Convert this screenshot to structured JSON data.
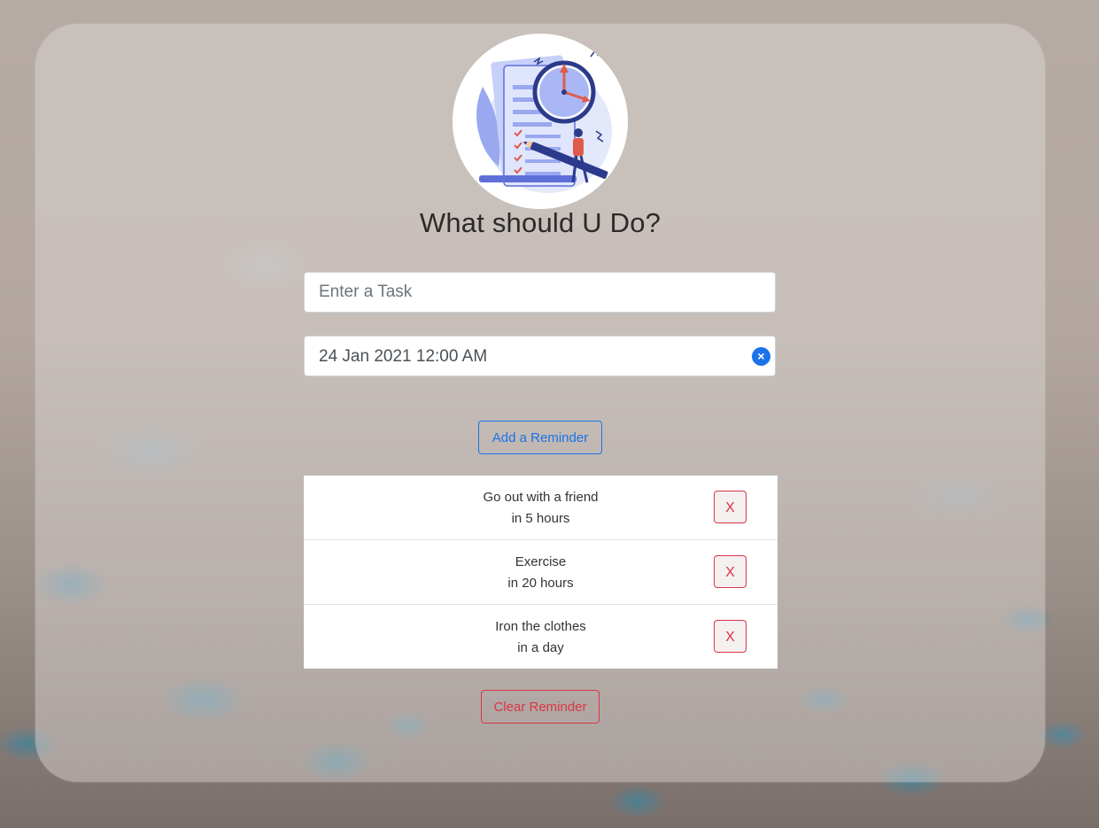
{
  "app": {
    "title": "What should U Do?",
    "logo_icon": "task-clock-illustration-icon"
  },
  "form": {
    "task_placeholder": "Enter a Task",
    "task_value": "",
    "date_value": "24 Jan 2021 12:00 AM",
    "date_clear_symbol": "×",
    "add_button_label": "Add a Reminder"
  },
  "reminders": [
    {
      "text": "Go out with a friend",
      "time": "in 5 hours",
      "delete_label": "X"
    },
    {
      "text": "Exercise",
      "time": "in 20 hours",
      "delete_label": "X"
    },
    {
      "text": "Iron the clothes",
      "time": "in a day",
      "delete_label": "X"
    }
  ],
  "footer": {
    "clear_button_label": "Clear Reminder"
  },
  "colors": {
    "primary": "#1a73e8",
    "danger": "#dc3545"
  }
}
